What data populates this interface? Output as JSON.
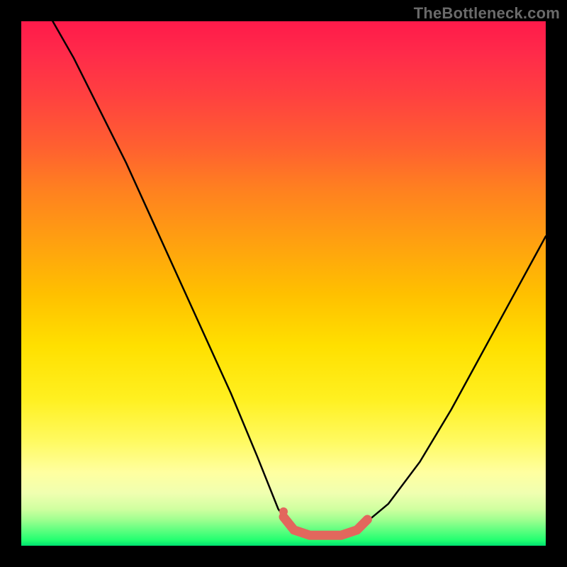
{
  "watermark": "TheBottleneck.com",
  "colors": {
    "curve": "#000000",
    "highlight": "#e2675d",
    "background_top": "#ff1a4a",
    "background_bottom": "#00e070",
    "frame": "#000000"
  },
  "chart_data": {
    "type": "line",
    "title": "",
    "xlabel": "",
    "ylabel": "",
    "xlim": [
      0,
      100
    ],
    "ylim": [
      0,
      100
    ],
    "legend": null,
    "grid": false,
    "background": "rainbow-gradient (red top → green bottom), black frame",
    "series": [
      {
        "name": "bottleneck-curve",
        "color": "#000000",
        "x": [
          6,
          10,
          15,
          20,
          25,
          30,
          35,
          40,
          45,
          49,
          52,
          55,
          58,
          61,
          64,
          70,
          76,
          82,
          88,
          94,
          100
        ],
        "y": [
          100,
          93,
          83,
          73,
          62,
          51,
          40,
          29,
          17,
          7,
          3,
          2,
          2,
          2,
          3,
          8,
          16,
          26,
          37,
          48,
          59
        ]
      }
    ],
    "annotations": [
      {
        "name": "trough-highlight",
        "type": "line-segment",
        "color": "#e2675d",
        "stroke_width": 13,
        "x": [
          50,
          52,
          55,
          58,
          61,
          64,
          66
        ],
        "y": [
          5.5,
          3,
          2,
          2,
          2,
          3,
          5
        ]
      },
      {
        "name": "trough-marker-dot",
        "type": "point",
        "color": "#e2675d",
        "x": 50,
        "y": 6.5
      }
    ]
  }
}
